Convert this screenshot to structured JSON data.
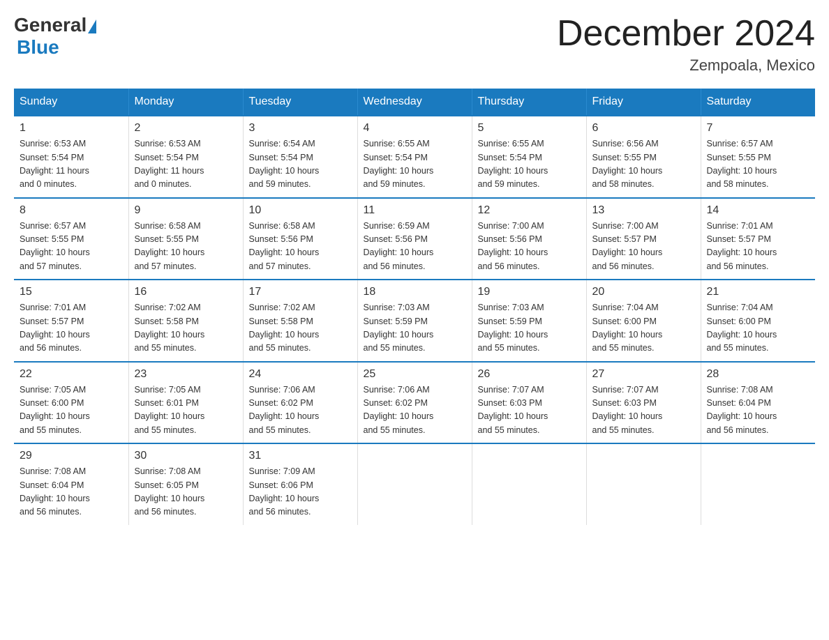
{
  "logo": {
    "general": "General",
    "blue": "Blue"
  },
  "title": "December 2024",
  "location": "Zempoala, Mexico",
  "days_of_week": [
    "Sunday",
    "Monday",
    "Tuesday",
    "Wednesday",
    "Thursday",
    "Friday",
    "Saturday"
  ],
  "weeks": [
    [
      {
        "day": "1",
        "sunrise": "6:53 AM",
        "sunset": "5:54 PM",
        "daylight": "11 hours and 0 minutes."
      },
      {
        "day": "2",
        "sunrise": "6:53 AM",
        "sunset": "5:54 PM",
        "daylight": "11 hours and 0 minutes."
      },
      {
        "day": "3",
        "sunrise": "6:54 AM",
        "sunset": "5:54 PM",
        "daylight": "10 hours and 59 minutes."
      },
      {
        "day": "4",
        "sunrise": "6:55 AM",
        "sunset": "5:54 PM",
        "daylight": "10 hours and 59 minutes."
      },
      {
        "day": "5",
        "sunrise": "6:55 AM",
        "sunset": "5:54 PM",
        "daylight": "10 hours and 59 minutes."
      },
      {
        "day": "6",
        "sunrise": "6:56 AM",
        "sunset": "5:55 PM",
        "daylight": "10 hours and 58 minutes."
      },
      {
        "day": "7",
        "sunrise": "6:57 AM",
        "sunset": "5:55 PM",
        "daylight": "10 hours and 58 minutes."
      }
    ],
    [
      {
        "day": "8",
        "sunrise": "6:57 AM",
        "sunset": "5:55 PM",
        "daylight": "10 hours and 57 minutes."
      },
      {
        "day": "9",
        "sunrise": "6:58 AM",
        "sunset": "5:55 PM",
        "daylight": "10 hours and 57 minutes."
      },
      {
        "day": "10",
        "sunrise": "6:58 AM",
        "sunset": "5:56 PM",
        "daylight": "10 hours and 57 minutes."
      },
      {
        "day": "11",
        "sunrise": "6:59 AM",
        "sunset": "5:56 PM",
        "daylight": "10 hours and 56 minutes."
      },
      {
        "day": "12",
        "sunrise": "7:00 AM",
        "sunset": "5:56 PM",
        "daylight": "10 hours and 56 minutes."
      },
      {
        "day": "13",
        "sunrise": "7:00 AM",
        "sunset": "5:57 PM",
        "daylight": "10 hours and 56 minutes."
      },
      {
        "day": "14",
        "sunrise": "7:01 AM",
        "sunset": "5:57 PM",
        "daylight": "10 hours and 56 minutes."
      }
    ],
    [
      {
        "day": "15",
        "sunrise": "7:01 AM",
        "sunset": "5:57 PM",
        "daylight": "10 hours and 56 minutes."
      },
      {
        "day": "16",
        "sunrise": "7:02 AM",
        "sunset": "5:58 PM",
        "daylight": "10 hours and 55 minutes."
      },
      {
        "day": "17",
        "sunrise": "7:02 AM",
        "sunset": "5:58 PM",
        "daylight": "10 hours and 55 minutes."
      },
      {
        "day": "18",
        "sunrise": "7:03 AM",
        "sunset": "5:59 PM",
        "daylight": "10 hours and 55 minutes."
      },
      {
        "day": "19",
        "sunrise": "7:03 AM",
        "sunset": "5:59 PM",
        "daylight": "10 hours and 55 minutes."
      },
      {
        "day": "20",
        "sunrise": "7:04 AM",
        "sunset": "6:00 PM",
        "daylight": "10 hours and 55 minutes."
      },
      {
        "day": "21",
        "sunrise": "7:04 AM",
        "sunset": "6:00 PM",
        "daylight": "10 hours and 55 minutes."
      }
    ],
    [
      {
        "day": "22",
        "sunrise": "7:05 AM",
        "sunset": "6:00 PM",
        "daylight": "10 hours and 55 minutes."
      },
      {
        "day": "23",
        "sunrise": "7:05 AM",
        "sunset": "6:01 PM",
        "daylight": "10 hours and 55 minutes."
      },
      {
        "day": "24",
        "sunrise": "7:06 AM",
        "sunset": "6:02 PM",
        "daylight": "10 hours and 55 minutes."
      },
      {
        "day": "25",
        "sunrise": "7:06 AM",
        "sunset": "6:02 PM",
        "daylight": "10 hours and 55 minutes."
      },
      {
        "day": "26",
        "sunrise": "7:07 AM",
        "sunset": "6:03 PM",
        "daylight": "10 hours and 55 minutes."
      },
      {
        "day": "27",
        "sunrise": "7:07 AM",
        "sunset": "6:03 PM",
        "daylight": "10 hours and 55 minutes."
      },
      {
        "day": "28",
        "sunrise": "7:08 AM",
        "sunset": "6:04 PM",
        "daylight": "10 hours and 56 minutes."
      }
    ],
    [
      {
        "day": "29",
        "sunrise": "7:08 AM",
        "sunset": "6:04 PM",
        "daylight": "10 hours and 56 minutes."
      },
      {
        "day": "30",
        "sunrise": "7:08 AM",
        "sunset": "6:05 PM",
        "daylight": "10 hours and 56 minutes."
      },
      {
        "day": "31",
        "sunrise": "7:09 AM",
        "sunset": "6:06 PM",
        "daylight": "10 hours and 56 minutes."
      },
      null,
      null,
      null,
      null
    ]
  ]
}
